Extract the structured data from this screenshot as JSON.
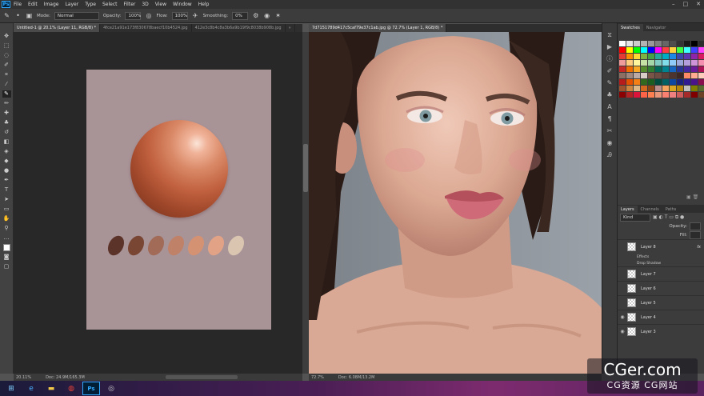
{
  "menubar": {
    "logo": "Ps",
    "items": [
      "File",
      "Edit",
      "Image",
      "Layer",
      "Type",
      "Select",
      "Filter",
      "3D",
      "View",
      "Window",
      "Help"
    ]
  },
  "options": {
    "mode_label": "Mode:",
    "mode_value": "Normal",
    "opacity_label": "Opacity:",
    "opacity_value": "100%",
    "flow_label": "Flow:",
    "flow_value": "100%",
    "smoothing_label": "Smoothing:",
    "smoothing_value": "0%"
  },
  "tabs": [
    {
      "label": "Untitled-1 @ 20.1% (Layer 11, RGB/8) *",
      "active": true
    },
    {
      "label": "4fce21a91e173f830678baecf10b4524.jpg",
      "active": false
    },
    {
      "label": "412e3c8b4c8a3b6a9b19f9c8038b908b.jpg",
      "active": false
    },
    {
      "label": "7d7151789d417c5caf79e37c1ab.jpg @ 72.7% (Layer 1, RGB/8) *",
      "active": true
    },
    {
      "label": "»",
      "active": false
    }
  ],
  "status": {
    "zoom1": "20.11%",
    "doc1": "Doc: 24.9M/165.3M",
    "zoom2": "72.7%",
    "doc2": "Doc: 6.08M/13.2M"
  },
  "panels": {
    "swatches_tab": "Swatches",
    "navigator_tab": "Navigator",
    "layers_tab": "Layers",
    "channels_tab": "Channels",
    "paths_tab": "Paths",
    "kind_label": "Kind",
    "opacity_label": "Opacity:",
    "fill_label": "Fill:"
  },
  "layers": [
    {
      "name": "Layer 8",
      "fx": "fx"
    },
    {
      "name": "Layer 7"
    },
    {
      "name": "Layer 6"
    },
    {
      "name": "Layer 5"
    },
    {
      "name": "Layer 4"
    },
    {
      "name": "Layer 3"
    }
  ],
  "layer_effects": {
    "effects": "Effects",
    "drop_shadow": "Drop Shadow"
  },
  "palette": {
    "dabs": [
      "#5c3329",
      "#7a4634",
      "#a16b57",
      "#c08169",
      "#d49273",
      "#e2a286",
      "#d9c5b0"
    ],
    "sphere_base": "#c1613f"
  },
  "swatch_colors": [
    "#ffffff",
    "#e6e6e6",
    "#cccccc",
    "#b3b3b3",
    "#999999",
    "#808080",
    "#666666",
    "#4d4d4d",
    "#333333",
    "#1a1a1a",
    "#000000",
    "#2b2b2b",
    "#ff0000",
    "#ffff00",
    "#00ff00",
    "#00ffff",
    "#0000ff",
    "#ff00ff",
    "#ff4040",
    "#ffd040",
    "#40ff40",
    "#40ffff",
    "#4040ff",
    "#ff40ff",
    "#e53935",
    "#fb8c00",
    "#fdd835",
    "#7cb342",
    "#43a047",
    "#26a69a",
    "#00acc1",
    "#1e88e5",
    "#3949ab",
    "#5e35b1",
    "#8e24aa",
    "#d81b60",
    "#ef9a9a",
    "#ffcc80",
    "#fff59d",
    "#c5e1a5",
    "#a5d6a7",
    "#80cbc4",
    "#80deea",
    "#90caf9",
    "#9fa8da",
    "#b39ddb",
    "#ce93d8",
    "#f48fb1",
    "#c62828",
    "#ef6c00",
    "#f9a825",
    "#558b2f",
    "#2e7d32",
    "#00695c",
    "#00838f",
    "#1565c0",
    "#283593",
    "#4527a0",
    "#6a1b9a",
    "#ad1457",
    "#8d6e63",
    "#a1887f",
    "#bcaaa4",
    "#d7ccc8",
    "#795548",
    "#6d4c41",
    "#5d4037",
    "#4e342e",
    "#3e2723",
    "#ff8a65",
    "#ffab91",
    "#ffccbc",
    "#b71c1c",
    "#e65100",
    "#f57f17",
    "#33691e",
    "#1b5e20",
    "#004d40",
    "#006064",
    "#0d47a1",
    "#1a237e",
    "#311b92",
    "#4a148c",
    "#880e4f",
    "#a0522d",
    "#cd853f",
    "#deb887",
    "#d2691e",
    "#8b4513",
    "#bc8f8f",
    "#f4a460",
    "#daa520",
    "#b8860b",
    "#c0c0c0",
    "#808000",
    "#556b2f",
    "#8b0000",
    "#b22222",
    "#dc143c",
    "#ff6347",
    "#ff7f50",
    "#e9967a",
    "#fa8072",
    "#f08080",
    "#cd5c5c",
    "#a52a2a",
    "#800000",
    "#6b4226"
  ],
  "watermark": {
    "big": "CGer.com",
    "small": "CG资源 CG网站"
  }
}
